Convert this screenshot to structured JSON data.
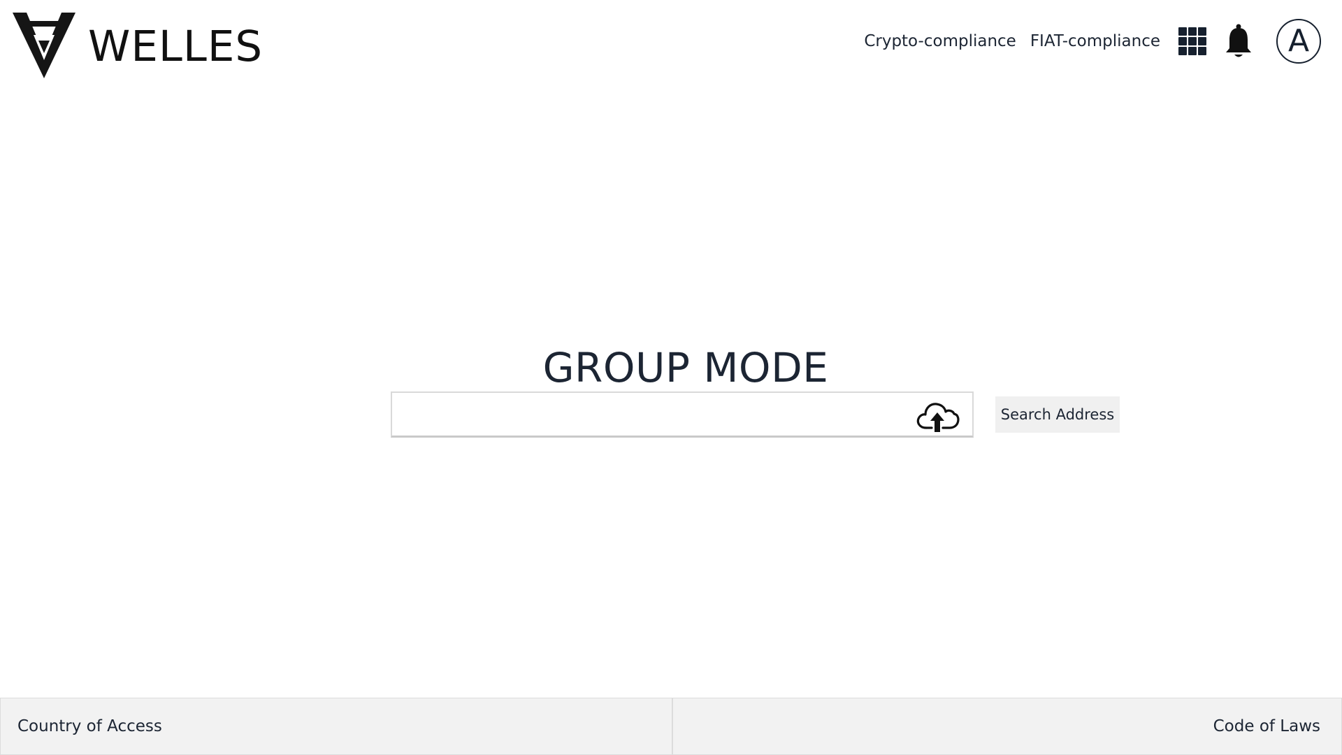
{
  "brand": {
    "name": "WELLES",
    "logo_icon": "welles-v-logo-icon"
  },
  "nav": {
    "links": [
      {
        "label": "Crypto-compliance"
      },
      {
        "label": "FIAT-compliance"
      }
    ],
    "apps_icon": "grid-apps-icon",
    "notifications_icon": "bell-icon",
    "avatar_letter": "A"
  },
  "main": {
    "title": "GROUP MODE",
    "search": {
      "value": "",
      "placeholder": "",
      "upload_icon": "cloud-upload-icon"
    },
    "search_button_label": "Search Address"
  },
  "footer": {
    "left_label": "Country of Access",
    "right_label": "Code of Laws"
  },
  "colors": {
    "text": "#1c2533",
    "footer_bg": "#f2f2f2",
    "button_bg": "#f0f0f0",
    "border": "#d9d9d9"
  }
}
